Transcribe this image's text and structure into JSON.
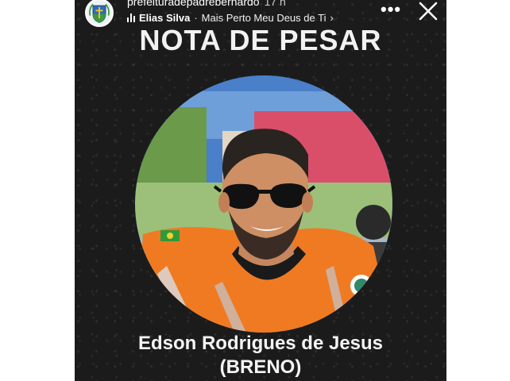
{
  "story": {
    "account_name": "prefeituradepadrebernardo",
    "time_ago": "17 h",
    "music": {
      "artist": "Elias Silva",
      "separator": "·",
      "song": "Mais Perto Meu Deus de Ti",
      "chevron": "›"
    },
    "more_label": "•••",
    "close_icon": "close-icon"
  },
  "post": {
    "headline": "NOTA DE PESAR",
    "name_line1": "Edson Rodrigues de Jesus",
    "name_line2": "(BRENO)"
  },
  "colors": {
    "background": "#1b1b1b",
    "text": "#ffffff",
    "shirt_orange": "#f07a22"
  }
}
